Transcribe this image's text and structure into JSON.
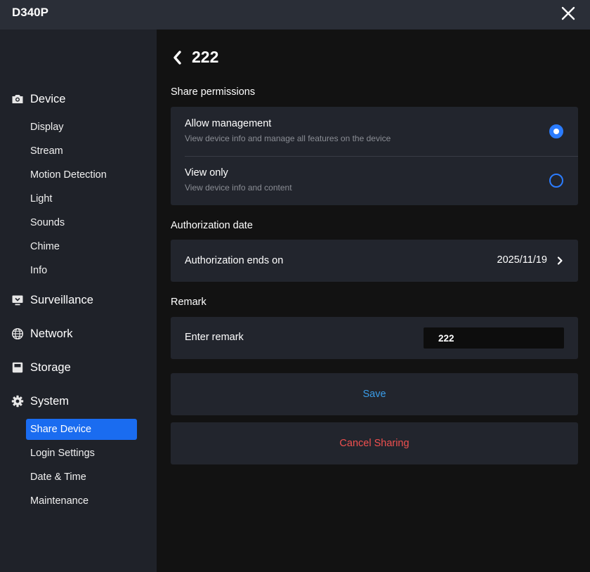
{
  "window": {
    "title": "D340P",
    "close_icon": "close-icon"
  },
  "sidebar": {
    "groups": [
      {
        "label": "Device",
        "icon": "camera-icon",
        "items": [
          "Display",
          "Stream",
          "Motion Detection",
          "Light",
          "Sounds",
          "Chime",
          "Info"
        ]
      },
      {
        "label": "Surveillance",
        "icon": "monitor-icon",
        "items": []
      },
      {
        "label": "Network",
        "icon": "globe-icon",
        "items": []
      },
      {
        "label": "Storage",
        "icon": "storage-icon",
        "items": []
      },
      {
        "label": "System",
        "icon": "gear-icon",
        "items": [
          "Share Device",
          "Login Settings",
          "Date & Time",
          "Maintenance"
        ]
      }
    ],
    "active_item": "Share Device"
  },
  "main": {
    "title": "222",
    "permissions": {
      "section_label": "Share permissions",
      "options": [
        {
          "title": "Allow management",
          "description": "View device info and manage all features on the device",
          "selected": true
        },
        {
          "title": "View only",
          "description": "View device info and content",
          "selected": false
        }
      ]
    },
    "authorization": {
      "section_label": "Authorization date",
      "row_label": "Authorization ends on",
      "value": "2025/11/19"
    },
    "remark": {
      "section_label": "Remark",
      "row_label": "Enter remark",
      "value": "222"
    },
    "buttons": {
      "save": "Save",
      "cancel": "Cancel Sharing"
    }
  },
  "colors": {
    "accent": "#1a6cf0",
    "radio": "#2b7cff",
    "save_text": "#3a9ce8",
    "cancel_text": "#f0504f",
    "sidebar_bg": "#1f2229",
    "main_bg": "#121212",
    "card_bg": "#22252d"
  }
}
